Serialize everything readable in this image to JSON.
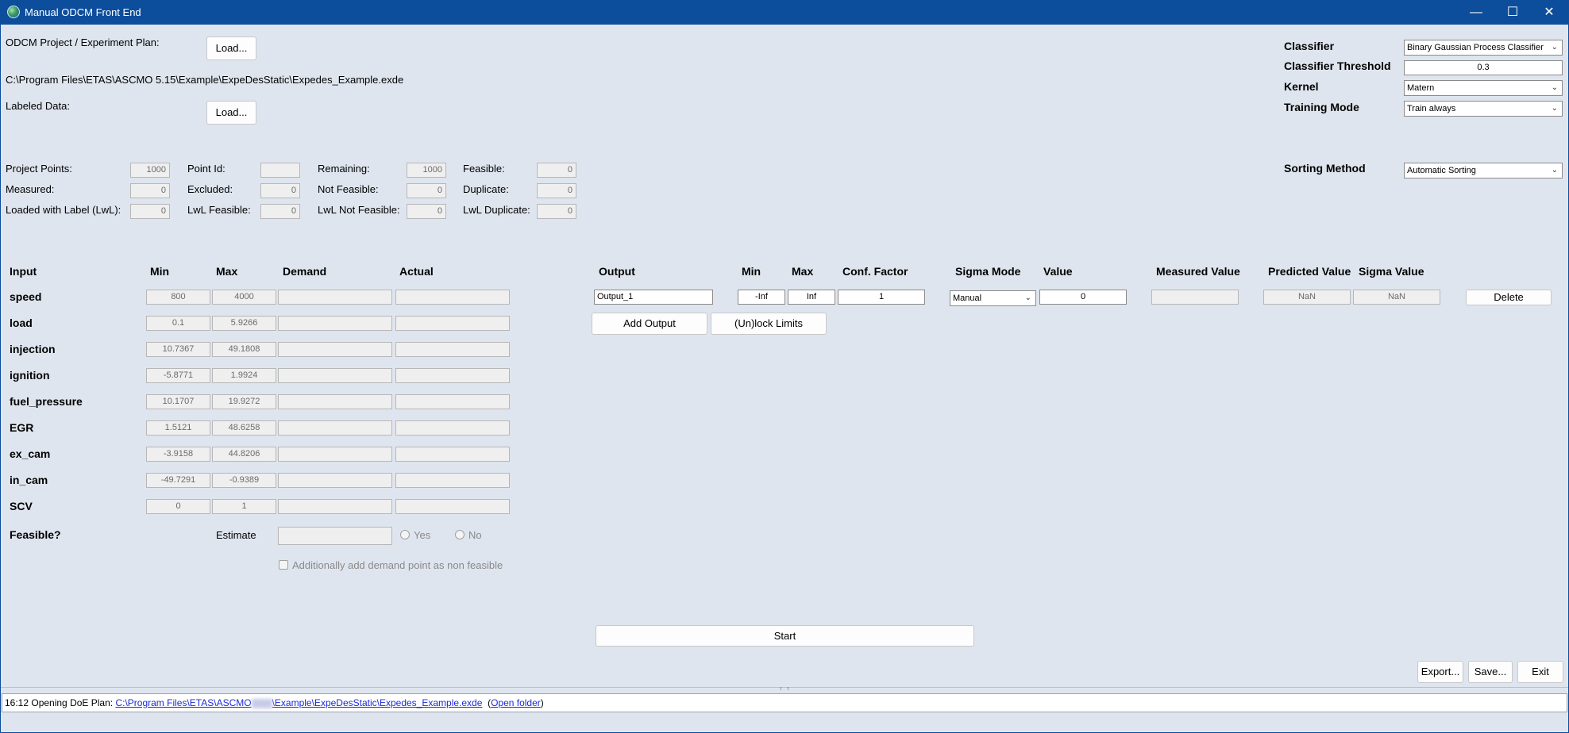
{
  "window": {
    "title": "Manual ODCM Front End",
    "minimize": "—",
    "maximize": "☐",
    "close": "✕"
  },
  "project": {
    "label": "ODCM Project / Experiment Plan:",
    "load_label": "Load...",
    "path": "C:\\Program Files\\ETAS\\ASCMO 5.15\\Example\\ExpeDesStatic\\Expedes_Example.exde",
    "labeled_label": "Labeled Data:",
    "labeled_load_label": "Load..."
  },
  "classifier": {
    "classifier_label": "Classifier",
    "classifier_value": "Binary Gaussian Process Classifier",
    "threshold_label": "Classifier Threshold",
    "threshold_value": "0.3",
    "kernel_label": "Kernel",
    "kernel_value": "Matern",
    "training_label": "Training Mode",
    "training_value": "Train always",
    "sorting_label": "Sorting Method",
    "sorting_value": "Automatic Sorting"
  },
  "stats": {
    "project_points": {
      "label": "Project Points:",
      "value": "1000"
    },
    "measured": {
      "label": "Measured:",
      "value": "0"
    },
    "loaded_lwl": {
      "label": "Loaded with Label (LwL):",
      "value": "0"
    },
    "point_id": {
      "label": "Point Id:",
      "value": ""
    },
    "excluded": {
      "label": "Excluded:",
      "value": "0"
    },
    "lwl_feasible": {
      "label": "LwL Feasible:",
      "value": "0"
    },
    "remaining": {
      "label": "Remaining:",
      "value": "1000"
    },
    "not_feasible": {
      "label": "Not Feasible:",
      "value": "0"
    },
    "lwl_not_feasible": {
      "label": "LwL Not Feasible:",
      "value": "0"
    },
    "feasible": {
      "label": "Feasible:",
      "value": "0"
    },
    "duplicate": {
      "label": "Duplicate:",
      "value": "0"
    },
    "lwl_duplicate": {
      "label": "LwL Duplicate:",
      "value": "0"
    }
  },
  "inputs": {
    "headers": {
      "input": "Input",
      "min": "Min",
      "max": "Max",
      "demand": "Demand",
      "actual": "Actual"
    },
    "rows": [
      {
        "name": "speed",
        "min": "800",
        "max": "4000"
      },
      {
        "name": "load",
        "min": "0.1",
        "max": "5.9266"
      },
      {
        "name": "injection",
        "min": "10.7367",
        "max": "49.1808"
      },
      {
        "name": "ignition",
        "min": "-5.8771",
        "max": "1.9924"
      },
      {
        "name": "fuel_pressure",
        "min": "10.1707",
        "max": "19.9272"
      },
      {
        "name": "EGR",
        "min": "1.5121",
        "max": "48.6258"
      },
      {
        "name": "ex_cam",
        "min": "-3.9158",
        "max": "44.8206"
      },
      {
        "name": "in_cam",
        "min": "-49.7291",
        "max": "-0.9389"
      },
      {
        "name": "SCV",
        "min": "0",
        "max": "1"
      }
    ],
    "feasible_label": "Feasible?",
    "estimate_label": "Estimate",
    "yes_label": "Yes",
    "no_label": "No",
    "additionally_label": "Additionally add demand point as non feasible"
  },
  "outputs": {
    "headers": {
      "output": "Output",
      "min": "Min",
      "max": "Max",
      "conf": "Conf. Factor",
      "sigma_mode": "Sigma Mode",
      "value": "Value",
      "measured": "Measured Value",
      "predicted": "Predicted Value",
      "sigma_value": "Sigma Value"
    },
    "row": {
      "name": "Output_1",
      "min": "-Inf",
      "max": "Inf",
      "conf": "1",
      "sigma_mode": "Manual",
      "value": "0",
      "measured": "",
      "predicted": "NaN",
      "sigma_value": "NaN",
      "delete_label": "Delete"
    },
    "add_output_label": "Add Output",
    "unlock_label": "(Un)lock Limits"
  },
  "actions": {
    "start": "Start",
    "export": "Export...",
    "save": "Save...",
    "exit": "Exit"
  },
  "status": {
    "prefix": "16:12 Opening DoE Plan: ",
    "link_start": "C:\\Program Files\\ETAS\\ASCMO",
    "link_end": "\\Example\\ExpeDesStatic\\Expedes_Example.exde",
    "open_folder_pre": "(",
    "open_folder": "Open folder",
    "open_folder_post": ")"
  }
}
